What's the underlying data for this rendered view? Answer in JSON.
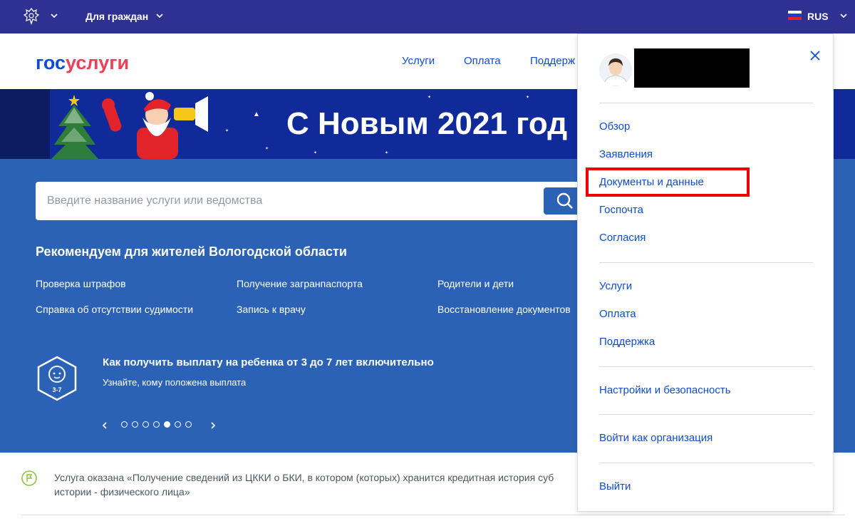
{
  "topbar": {
    "for_citizens": "Для граждан",
    "lang": "RUS"
  },
  "header": {
    "logo_part1": "гос",
    "logo_part2": "услуги",
    "nav": [
      "Услуги",
      "Оплата",
      "Поддерж"
    ]
  },
  "banner": {
    "title": "С Новым 2021 год"
  },
  "search": {
    "placeholder": "Введите название услуги или ведомства"
  },
  "recommend": {
    "title": "Рекомендуем для жителей Вологодской области",
    "links": [
      "Проверка штрафов",
      "Получение загранпаспорта",
      "Родители и дети",
      "Справка об отсутствии судимости",
      "Запись к врачу",
      "Восстановление документов"
    ]
  },
  "promo": {
    "badge": "3-7",
    "title": "Как получить выплату на ребенка от 3 до 7 лет включительно",
    "subtitle": "Узнайте, кому положена выплата",
    "active_dot": 4,
    "dot_count": 7
  },
  "notice": {
    "text": "Услуга оказана «Получение сведений из ЦККИ о БКИ, в котором (которых) хранится кредитная история субъекта кредитной истории - физического лица»",
    "line1": "Услуга оказана «Получение сведений из ЦККИ о БКИ, в котором (которых) хранится кредитная история суб",
    "line2": "истории - физического лица»"
  },
  "panel": {
    "menu_group1": [
      "Обзор",
      "Заявления",
      "Документы и данные",
      "Госпочта",
      "Согласия"
    ],
    "menu_group2": [
      "Услуги",
      "Оплата",
      "Поддержка"
    ],
    "settings": "Настройки и безопасность",
    "org_login": "Войти как организация",
    "logout": "Выйти"
  },
  "colors": {
    "topbar": "#2e3192",
    "brand_blue": "#0d4cd3",
    "brand_red": "#ee3f58",
    "hero_blue": "#2c62b6",
    "highlight": "#ee0000"
  }
}
